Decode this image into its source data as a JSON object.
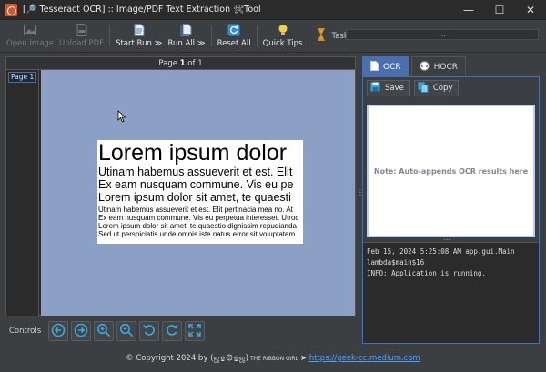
{
  "window": {
    "title": "[🔎 Tesseract OCR] :: Image/PDF Text Extraction 🛠Tool",
    "controls": {
      "minimize": "—",
      "maximize": "☐",
      "close": "✕"
    }
  },
  "toolbar": {
    "open_image": "Open Image",
    "upload_pdf": "Upload PDF",
    "start_run": "Start Run ≫",
    "run_all": "Run All ≫",
    "reset_all": "Reset All",
    "quick_tips": "Quick Tips",
    "task_status_label": "Task Status",
    "task_status_value": "..."
  },
  "viewer": {
    "page_prefix": "Page ",
    "page_current": "1",
    "page_suffix": " of 1",
    "pages": [
      "Page 1"
    ],
    "document_lines": {
      "large": "Lorem ipsum dolor",
      "medium": [
        "Utinam habemus assueverit et est. Elit",
        "Ex eam nusquam commune. Vis eu pe",
        "Lorem ipsum dolor sit amet, te quaesti"
      ],
      "small": [
        "Utinam habemus assueverit et est. Elit pertinacia mea no. At",
        "Ex eam nusquam commune. Vis eu perpetua interesset. Utroc",
        "Lorem ipsum dolor sit amet, te quaestio dignissim repudianda",
        "Sed ut perspiciatis unde omnis iste natus error sit voluptatem"
      ]
    }
  },
  "controls": {
    "label": "Controls"
  },
  "right_panel": {
    "tabs": [
      {
        "label": "OCR",
        "active": true
      },
      {
        "label": "HOCR",
        "active": false
      }
    ],
    "save_label": "Save",
    "copy_label": "Copy",
    "ocr_placeholder": "Note: Auto-appends OCR results here",
    "log_text": "Feb 15, 2024 5:25:08 AM app.gui.Main\nlambda$main$16\nINFO: Application is running."
  },
  "footer": {
    "copyright": "© Copyright 2024 by ",
    "author": "(ஜ۩۞۩ஜ)",
    "tagline": " THE RIBBON GIRL ",
    "arrow": "➤",
    "link": "https://geek-cc.medium.com"
  },
  "colors": {
    "accent": "#4b6eaf",
    "canvas_bg": "#8ca0c5",
    "link": "#4ea0ff"
  }
}
